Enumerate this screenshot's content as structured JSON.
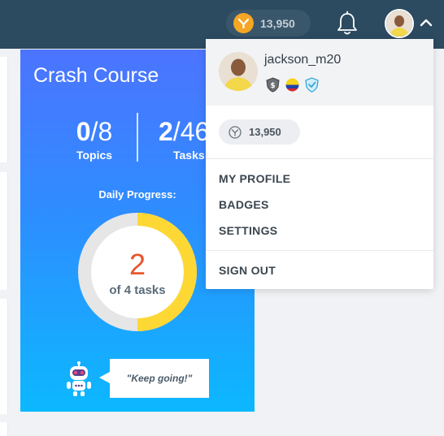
{
  "topbar": {
    "coins": "13,950",
    "coin_icon": "coin-icon",
    "bell_icon": "bell-icon",
    "chevron_icon": "chevron-up-icon"
  },
  "course_card": {
    "title": "Crash Course",
    "topics": {
      "done": "0",
      "total": "/8",
      "label": "Topics"
    },
    "tasks": {
      "done": "2",
      "total": "/46",
      "label": "Tasks"
    },
    "daily_progress_label": "Daily Progress:",
    "daily": {
      "done": "2",
      "subtitle": "of 4 tasks",
      "completed": 2,
      "goal": 4
    },
    "speech": "\"Keep going!\"",
    "gradient_top": "#4c74ff",
    "gradient_bottom": "#0cb8ff",
    "progress_color": "#fdd835"
  },
  "dropdown": {
    "username": "jackson_m20",
    "badges": [
      "dollar-shield-badge-icon",
      "colombia-flag-badge-icon",
      "blue-shield-badge-icon"
    ],
    "coins": "13,950",
    "menu": [
      {
        "label": "MY PROFILE"
      },
      {
        "label": "BADGES"
      },
      {
        "label": "SETTINGS"
      },
      {
        "label": "SIGN OUT"
      }
    ]
  }
}
